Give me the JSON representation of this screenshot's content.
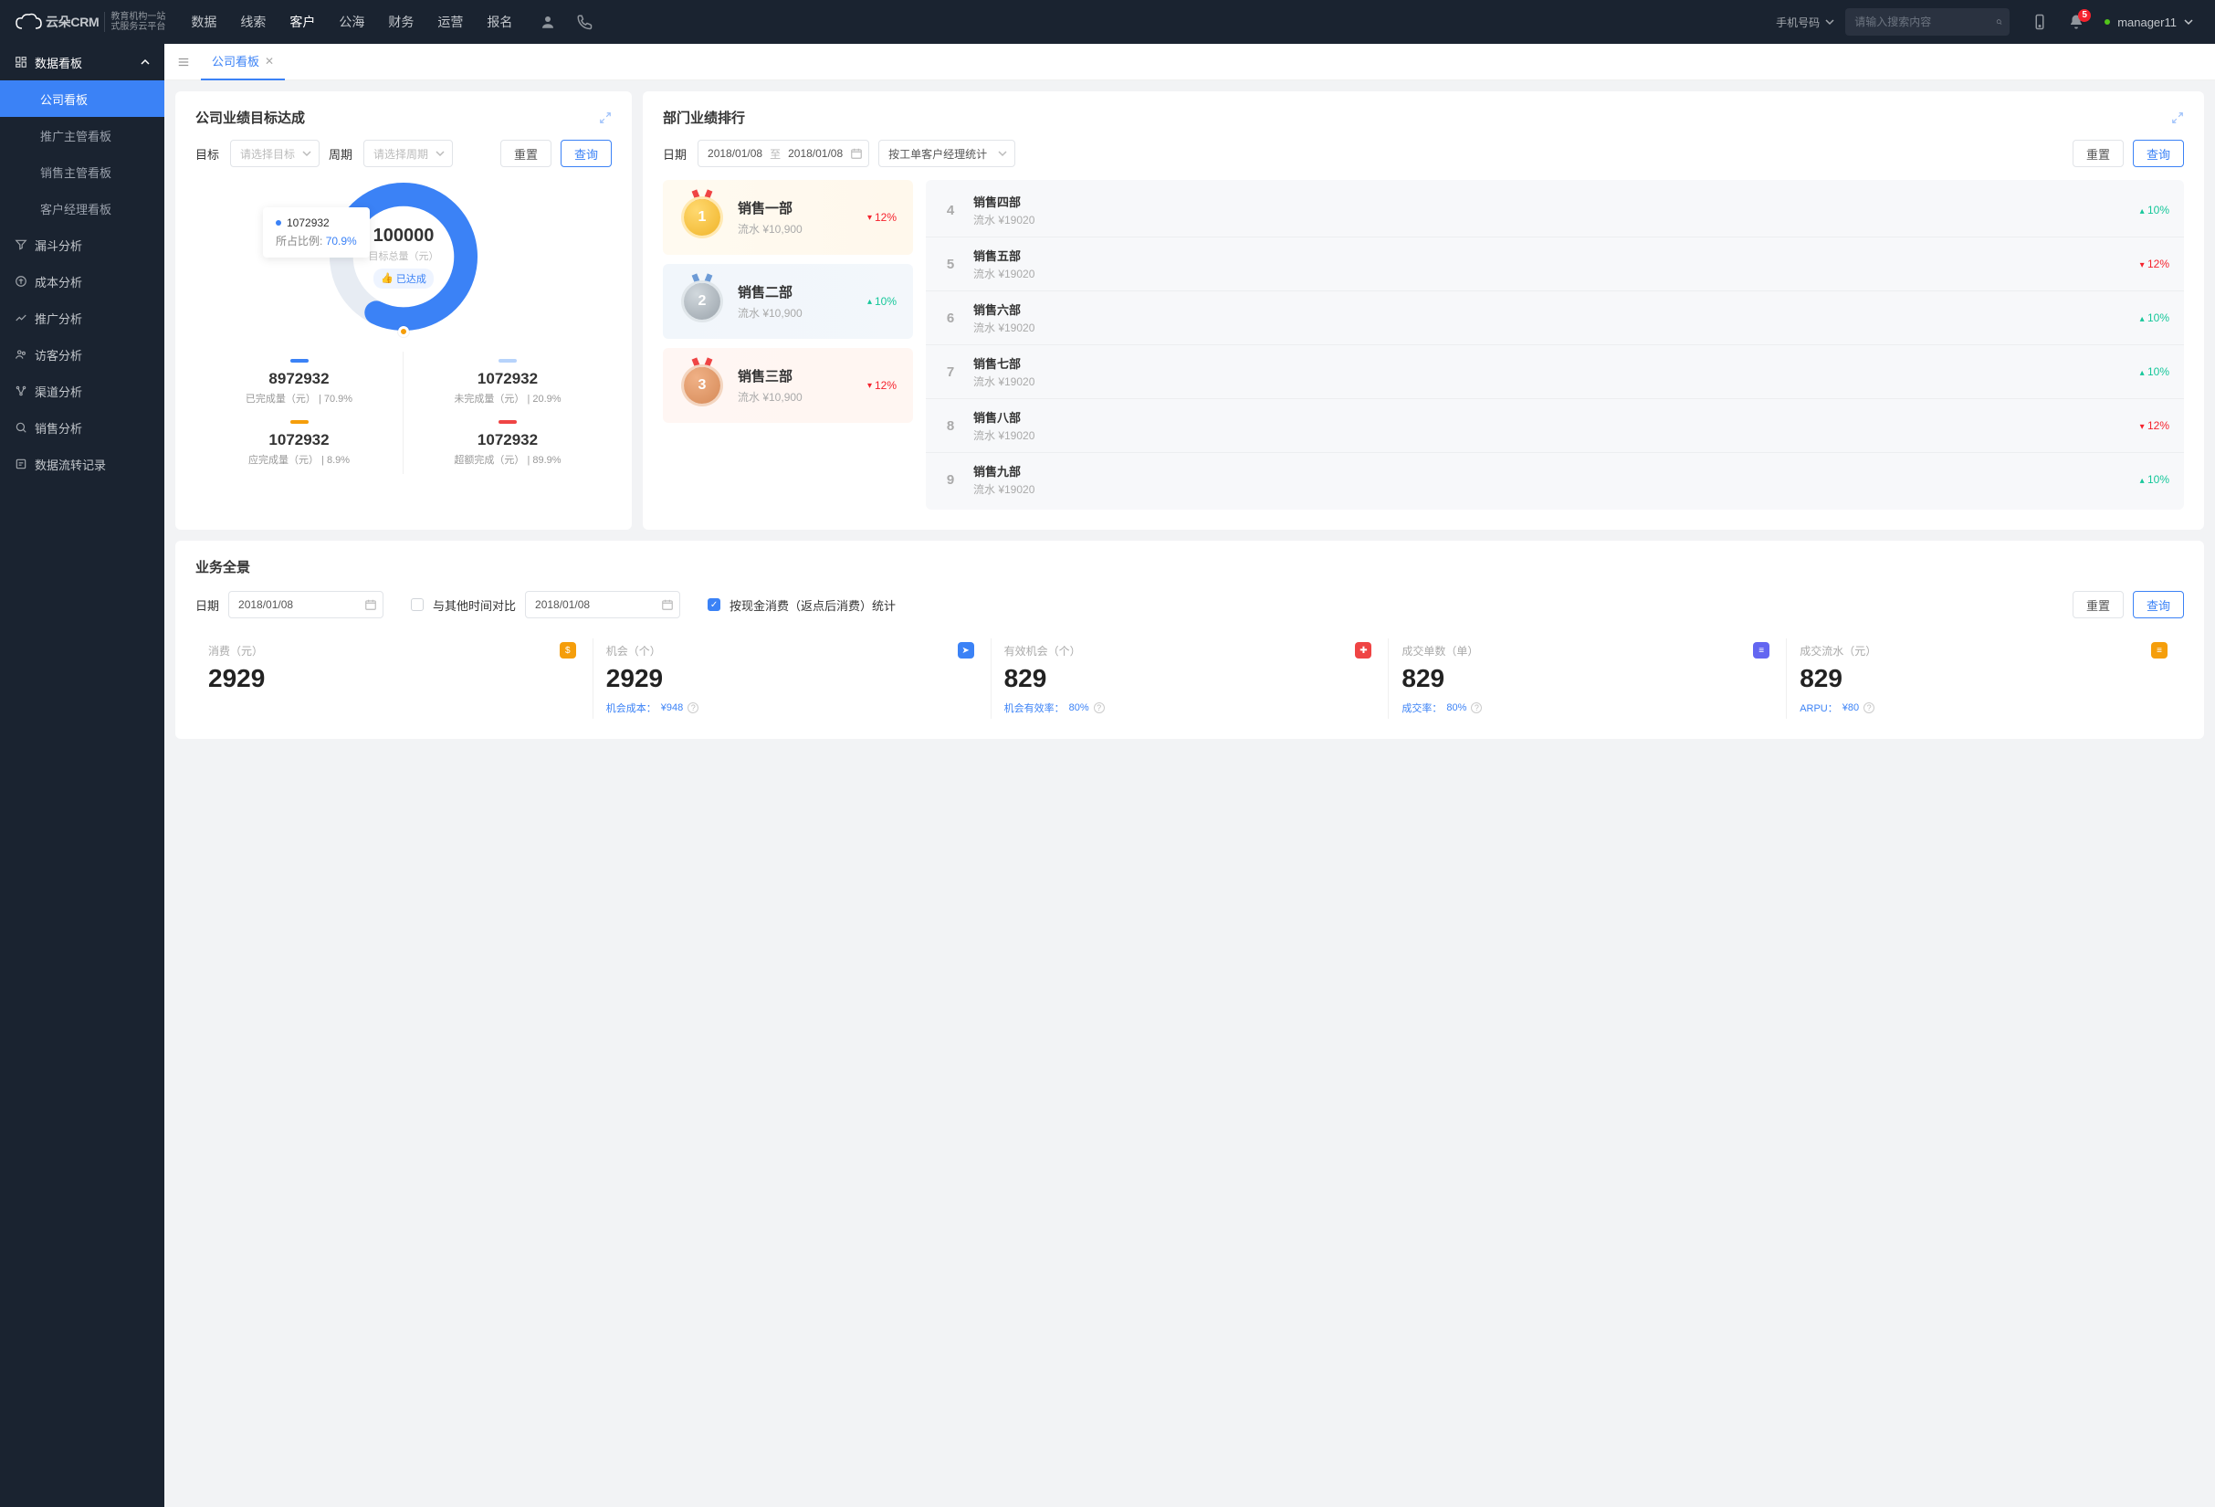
{
  "brand": {
    "crm": "云朵CRM",
    "sub1": "教育机构一站",
    "sub2": "式服务云平台"
  },
  "topnav": {
    "data": "数据",
    "leads": "线索",
    "customer": "客户",
    "public": "公海",
    "finance": "财务",
    "ops": "运营",
    "enroll": "报名"
  },
  "search": {
    "select": "手机号码",
    "placeholder": "请输入搜索内容"
  },
  "badge": "5",
  "user": "manager11",
  "sidebar": {
    "dashboard": "数据看板",
    "company": "公司看板",
    "promo": "推广主管看板",
    "sales": "销售主管看板",
    "cm": "客户经理看板",
    "funnel": "漏斗分析",
    "cost": "成本分析",
    "promo2": "推广分析",
    "visitor": "访客分析",
    "channel": "渠道分析",
    "salesa": "销售分析",
    "flow": "数据流转记录"
  },
  "tab": "公司看板",
  "target": {
    "title": "公司业绩目标达成",
    "f_target": "目标",
    "f_target_ph": "请选择目标",
    "f_cycle": "周期",
    "f_cycle_ph": "请选择周期",
    "reset": "重置",
    "query": "查询",
    "tooltip_val": "1072932",
    "tooltip_lbl": "所占比例:",
    "tooltip_pct": "70.9%",
    "total": "100000",
    "total_lbl": "目标总量（元）",
    "chip": "已达成",
    "legend": {
      "done_val": "8972932",
      "done_lbl": "已完成量（元）",
      "done_pct": "70.9%",
      "undone_val": "1072932",
      "undone_lbl": "未完成量（元）",
      "undone_pct": "20.9%",
      "should_val": "1072932",
      "should_lbl": "应完成量（元）",
      "should_pct": "8.9%",
      "over_val": "1072932",
      "over_lbl": "超额完成（元）",
      "over_pct": "89.9%"
    }
  },
  "ranking": {
    "title": "部门业绩排行",
    "f_date": "日期",
    "d1": "2018/01/08",
    "d_to": "至",
    "d2": "2018/01/08",
    "stat_by": "按工单客户经理统计",
    "reset": "重置",
    "query": "查询",
    "podium": [
      {
        "rank": "1",
        "name": "销售一部",
        "flow": "流水 ¥10,900",
        "pct": "12%",
        "dir": "dn"
      },
      {
        "rank": "2",
        "name": "销售二部",
        "flow": "流水 ¥10,900",
        "pct": "10%",
        "dir": "up"
      },
      {
        "rank": "3",
        "name": "销售三部",
        "flow": "流水 ¥10,900",
        "pct": "12%",
        "dir": "dn"
      }
    ],
    "list": [
      {
        "n": "4",
        "name": "销售四部",
        "flow": "流水 ¥19020",
        "pct": "10%",
        "dir": "up"
      },
      {
        "n": "5",
        "name": "销售五部",
        "flow": "流水 ¥19020",
        "pct": "12%",
        "dir": "dn"
      },
      {
        "n": "6",
        "name": "销售六部",
        "flow": "流水 ¥19020",
        "pct": "10%",
        "dir": "up"
      },
      {
        "n": "7",
        "name": "销售七部",
        "flow": "流水 ¥19020",
        "pct": "10%",
        "dir": "up"
      },
      {
        "n": "8",
        "name": "销售八部",
        "flow": "流水 ¥19020",
        "pct": "12%",
        "dir": "dn"
      },
      {
        "n": "9",
        "name": "销售九部",
        "flow": "流水 ¥19020",
        "pct": "10%",
        "dir": "up"
      }
    ]
  },
  "biz": {
    "title": "业务全景",
    "f_date": "日期",
    "d1": "2018/01/08",
    "compare": "与其他时间对比",
    "d2": "2018/01/08",
    "check_lbl": "按现金消费（返点后消费）统计",
    "reset": "重置",
    "query": "查询",
    "metrics": [
      {
        "label": "消费（元）",
        "val": "2929",
        "ico": "orange",
        "sub": ""
      },
      {
        "label": "机会（个）",
        "val": "2929",
        "ico": "blue",
        "sub_l": "机会成本：",
        "sub_v": "¥948"
      },
      {
        "label": "有效机会（个）",
        "val": "829",
        "ico": "red",
        "sub_l": "机会有效率：",
        "sub_v": "80%"
      },
      {
        "label": "成交单数（单）",
        "val": "829",
        "ico": "indigo",
        "sub_l": "成交率：",
        "sub_v": "80%"
      },
      {
        "label": "成交流水（元）",
        "val": "829",
        "ico": "amber",
        "sub_l": "ARPU：",
        "sub_v": "¥80"
      }
    ]
  },
  "chart_data": {
    "type": "pie",
    "title": "公司业绩目标达成",
    "total": 100000,
    "series": [
      {
        "name": "已完成量（元）",
        "value": 8972932,
        "pct": 70.9,
        "color": "#3b82f6"
      },
      {
        "name": "未完成量（元）",
        "value": 1072932,
        "pct": 20.9,
        "color": "#b7d3fb"
      },
      {
        "name": "应完成量（元）",
        "value": 1072932,
        "pct": 8.9,
        "color": "#f59e0b"
      },
      {
        "name": "超额完成（元）",
        "value": 1072932,
        "pct": 89.9,
        "color": "#ef4444"
      }
    ]
  }
}
